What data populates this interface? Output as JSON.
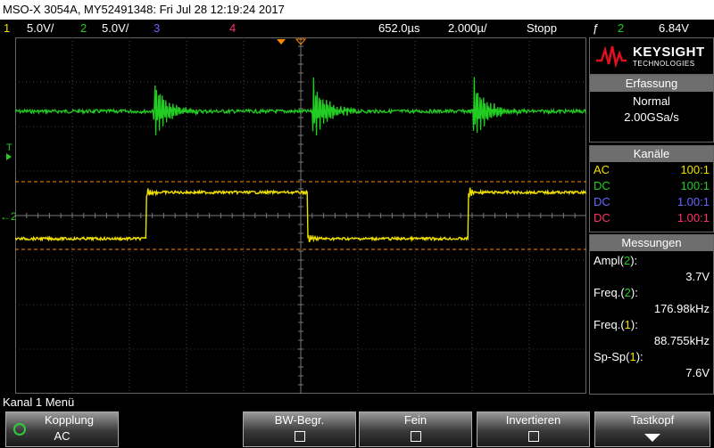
{
  "title": "MSO-X 3054A, MY52491348: Fri Jul 28 12:19:24 2017",
  "status": {
    "ch1_num": "1",
    "ch1_scale": "5.0V/",
    "ch2_num": "2",
    "ch2_scale": "5.0V/",
    "ch3_num": "3",
    "ch4_num": "4",
    "time_pos": "652.0µs",
    "time_scale": "2.000µ/",
    "run_state": "Stopp",
    "trigger_icon": "ƒ",
    "trigger_channel": "2",
    "trigger_level": "6.84V"
  },
  "colors": {
    "ch1": "#f0e000",
    "ch2": "#22cc22",
    "ch3": "#6666ff",
    "ch4": "#ff3366",
    "cursor": "#ff8800"
  },
  "screen": {
    "trigger_marker": "T",
    "ch2_marker": "2"
  },
  "brand": {
    "name": "KEYSIGHT",
    "sub": "TECHNOLOGIES"
  },
  "acquisition": {
    "header": "Erfassung",
    "mode": "Normal",
    "rate": "2.00GSa/s"
  },
  "channels": {
    "header": "Kanäle",
    "rows": [
      {
        "coupling": "AC",
        "probe": "100:1"
      },
      {
        "coupling": "DC",
        "probe": "100:1"
      },
      {
        "coupling": "DC",
        "probe": "1.00:1"
      },
      {
        "coupling": "DC",
        "probe": "1.00:1"
      }
    ]
  },
  "measurements": {
    "header": "Messungen",
    "items": [
      {
        "label_pre": "Ampl(",
        "ch": "2",
        "label_post": "):",
        "value": "3.7V"
      },
      {
        "label_pre": "Freq.(",
        "ch": "2",
        "label_post": "):",
        "value": "176.98kHz"
      },
      {
        "label_pre": "Freq.(",
        "ch": "1",
        "label_post": "):",
        "value": "88.755kHz"
      },
      {
        "label_pre": "Sp-Sp(",
        "ch": "1",
        "label_post": "):",
        "value": "7.6V"
      }
    ]
  },
  "menu": {
    "title": "Kanal 1 Menü",
    "kopplung": {
      "label": "Kopplung",
      "value": "AC"
    },
    "bw": "BW-Begr.",
    "fein": "Fein",
    "invertieren": "Invertieren",
    "tastkopf": "Tastkopf"
  }
}
